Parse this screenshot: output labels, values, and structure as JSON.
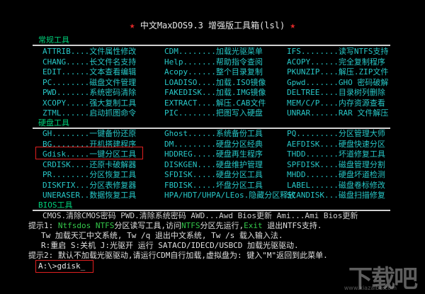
{
  "title": "中文MaxDOS9.3 增强版工具箱(lsl)",
  "star_glyph": "★",
  "sections": {
    "common": "常规工具",
    "disk": "硬盘工具",
    "bios": "BIOS工具"
  },
  "common_tools": [
    [
      "ATTRIB....文件属性修改",
      "CDM........加载光驱菜单",
      "IFS........读写NTFS支持"
    ],
    [
      "CHANG.....长文件名支持",
      "Help.......帮助指令查阅",
      "ACOPY......完全复制程序"
    ],
    [
      "EDIT......文本查看编辑",
      "Acopy......整个目录复制",
      "PKUNZIP....解压.ZIP文件"
    ],
    [
      "PC........磁盘文件管理",
      "LOADISO....加载.ISO镜像",
      "Gpwd.......GHO 密码破解"
    ],
    [
      "PWD.......系统密码清除",
      "FAKEDISK...加载.IMG镜像",
      "DELTREE....目录树列删除"
    ],
    [
      "XCOPY.....强大复制工具",
      "EXTRACT....解压.CAB文件",
      "MEM/C/P....内存资源查看"
    ],
    [
      "ZTML......启动抓图命令",
      "PIC........把图写入硬盘",
      "UNRAR......RAR 文件解压"
    ]
  ],
  "disk_tools": [
    [
      "GH........一键备份还原",
      "Ghost......系统备份工具",
      "PQ.........分区管理大师"
    ],
    [
      "BG........开机搭建程序",
      "DM.........硬盘分区经典",
      "AEFDISK....硬盘快速分区"
    ],
    [
      "Gdisk.....一键分区工具",
      "HDDREG.....硬盘再生程序",
      "THDD.......坏道修复工具"
    ],
    [
      "CRDISK....还原卡破解器",
      "DISKGEN....硬盘维护管理",
      "SPFDISK....磁盘管理分割"
    ],
    [
      "PR........分区恢复工具",
      "SFDISK.....硬盘分区工具",
      "MHDD.......硬盘坏道检测"
    ],
    [
      "DISKFIX...分区表修复器",
      "FBDISK.....坏盘分区工具",
      "LABEL......磁盘卷标修改"
    ],
    [
      "UNERASER..数据恢复工具",
      "HPA/HDT/UHPA/LEos.隐藏分区释放",
      "SCANDISK...磁盘扫描修复"
    ]
  ],
  "bios_tools": "CMOS.清除CMOS密码   PWD.清除系统密码   AWD...Awd Bios更新   Ami...Ami Bios更新",
  "tips": {
    "line1_prefix": "提示1: ",
    "line1_ntfs": "Ntfsdos  NTFS",
    "line1_mid": "分区读写工具,访问",
    "line1_ntfs2": "NTFS",
    "line1_mid2": "分区先运行,",
    "line1_exit": "Exit",
    "line1_end": " 退出NTFS支持.",
    "line2": "Tw  加载天汇中文系统, Tw /q 退出中文系统,  Tw /s 载入输入法.",
    "line3": "R:重启   S:关机    J:光驱开   运行 SATACD/IDECD/USBCD 加载光驱驱动.",
    "line4": "提示2: 默认不加载光驱驱动,请运行CDM自行加载,虚拟盘为:  键入\"M\"返回到此菜单."
  },
  "prompt": "A:\\>gdisk_",
  "watermark": "下载吧",
  "watermark_sub": "www.xiazaiba.com",
  "colors": {
    "background": "#000000",
    "tool_text": "#27c7c7",
    "section_head": "#00d07a",
    "highlight_box": "#e02020",
    "star": "#e02828"
  }
}
